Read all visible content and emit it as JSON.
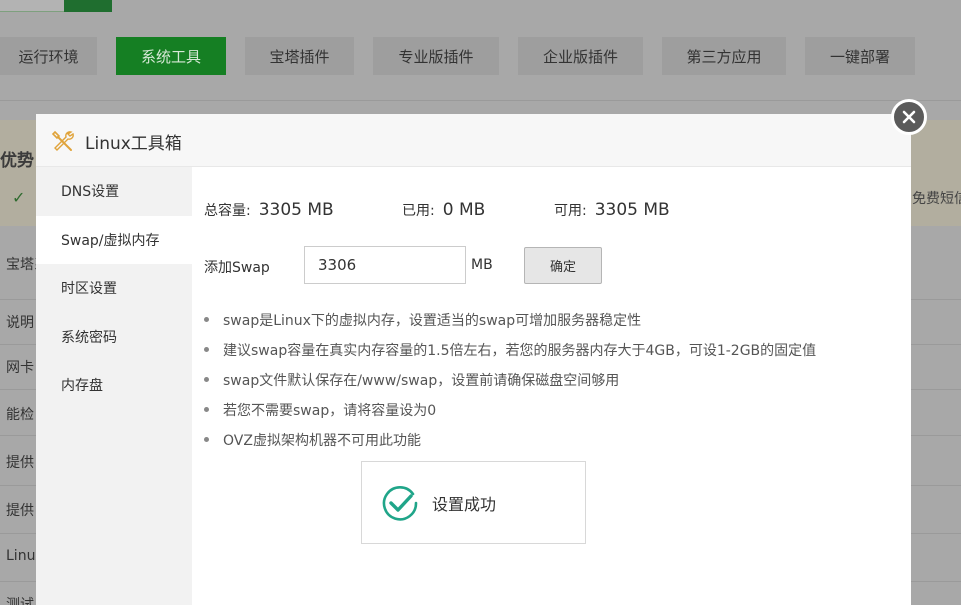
{
  "background": {
    "tabs": [
      {
        "label": "运行环境",
        "active": false
      },
      {
        "label": "系统工具",
        "active": true
      },
      {
        "label": "宝塔插件",
        "active": false
      },
      {
        "label": "专业版插件",
        "active": false
      },
      {
        "label": "企业版插件",
        "active": false
      },
      {
        "label": "第三方应用",
        "active": false
      },
      {
        "label": "一键部署",
        "active": false
      }
    ],
    "banner_title": "优势",
    "banner_right_text": "免费短信",
    "rows": [
      "宝塔系",
      "说明",
      "网卡",
      "能检",
      "提供",
      "提供",
      "Linux",
      "测试"
    ]
  },
  "modal": {
    "title": "Linux工具箱",
    "tool_icon": "tools-icon",
    "close_icon": "close-icon",
    "sidebar": [
      {
        "label": "DNS设置",
        "active": false
      },
      {
        "label": "Swap/虚拟内存",
        "active": true
      },
      {
        "label": "时区设置",
        "active": false
      },
      {
        "label": "系统密码",
        "active": false
      },
      {
        "label": "内存盘",
        "active": false
      }
    ],
    "stats": {
      "total_label": "总容量:",
      "total_value": "3305 MB",
      "used_label": "已用:",
      "used_value": "0 MB",
      "free_label": "可用:",
      "free_value": "3305 MB"
    },
    "add_swap": {
      "label": "添加Swap",
      "value": "3306",
      "unit": "MB",
      "confirm_label": "确定"
    },
    "tips": [
      "swap是Linux下的虚拟内存，设置适当的swap可增加服务器稳定性",
      "建议swap容量在真实内存容量的1.5倍左右，若您的服务器内存大于4GB，可设1-2GB的固定值",
      "swap文件默认保存在/www/swap，设置前请确保磁盘空间够用",
      "若您不需要swap，请将容量设为0",
      "OVZ虚拟架构机器不可用此功能"
    ]
  },
  "toast": {
    "icon": "check-circle-icon",
    "message": "设置成功",
    "color": "#20a589"
  }
}
